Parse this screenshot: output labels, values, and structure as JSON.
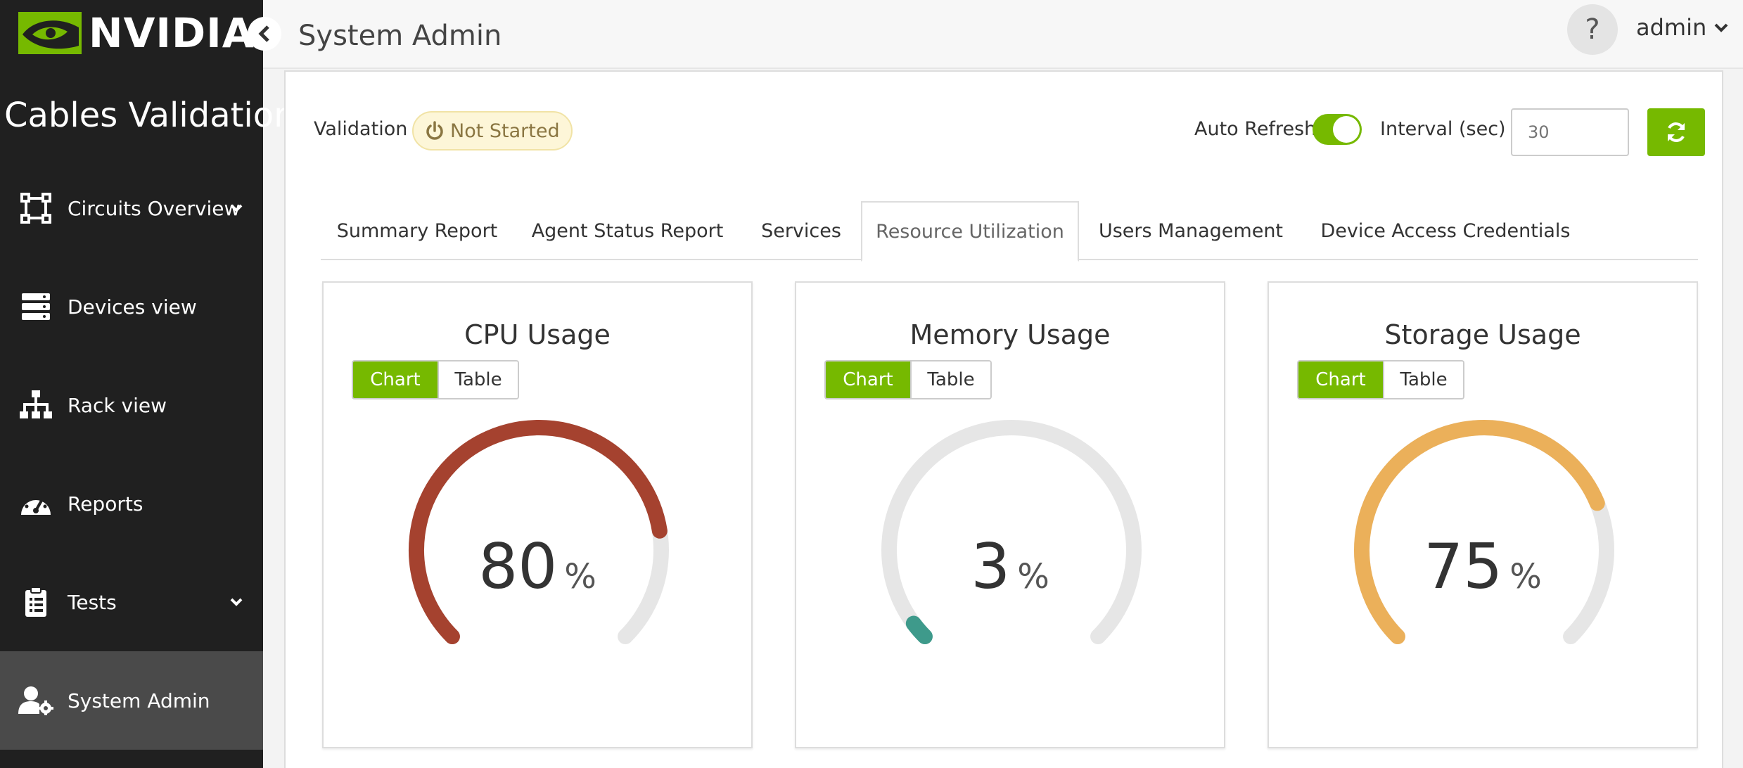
{
  "sidebar": {
    "logo_text": "NVIDIA",
    "app_title": "Cables Validation",
    "items": [
      {
        "label": "Circuits Overview",
        "icon": "circuits-icon",
        "has_children": true
      },
      {
        "label": "Devices view",
        "icon": "server-icon",
        "has_children": false
      },
      {
        "label": "Rack view",
        "icon": "sitemap-icon",
        "has_children": false
      },
      {
        "label": "Reports",
        "icon": "dashboard-icon",
        "has_children": false
      },
      {
        "label": "Tests",
        "icon": "clipboard-icon",
        "has_children": true
      },
      {
        "label": "System Admin",
        "icon": "user-cog-icon",
        "has_children": false,
        "active": true
      }
    ]
  },
  "header": {
    "title": "System Admin",
    "help_label": "?",
    "user": "admin"
  },
  "toolbar": {
    "validation_label": "Validation",
    "validation_status": "Not Started",
    "auto_refresh_label": "Auto Refresh",
    "auto_refresh_on": true,
    "interval_label": "Interval (sec)",
    "interval_placeholder": "30"
  },
  "tabs": [
    {
      "label": "Summary Report",
      "active": false
    },
    {
      "label": "Agent Status Report",
      "active": false
    },
    {
      "label": "Services",
      "active": false
    },
    {
      "label": "Resource Utilization",
      "active": true
    },
    {
      "label": "Users Management",
      "active": false
    },
    {
      "label": "Device Access Credentials",
      "active": false
    }
  ],
  "cards": [
    {
      "title": "CPU Usage",
      "chart_label": "Chart",
      "table_label": "Table",
      "value": "80",
      "unit": "%",
      "percent": 80,
      "color": "#a5422f"
    },
    {
      "title": "Memory Usage",
      "chart_label": "Chart",
      "table_label": "Table",
      "value": "3",
      "unit": "%",
      "percent": 3,
      "color": "#3e9a8b"
    },
    {
      "title": "Storage Usage",
      "chart_label": "Chart",
      "table_label": "Table",
      "value": "75",
      "unit": "%",
      "percent": 75,
      "color": "#ebb05a"
    }
  ],
  "colors": {
    "accent": "#76b900",
    "sidebar_bg": "#202020",
    "gauge_track": "#e6e6e6"
  }
}
